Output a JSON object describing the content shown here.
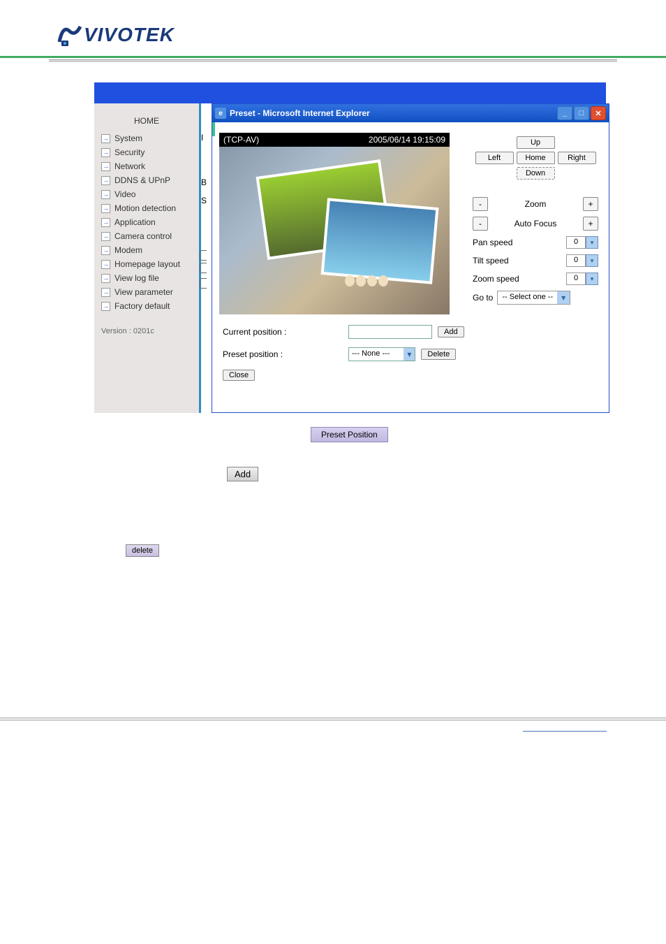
{
  "logo": {
    "text": "VIVOTEK"
  },
  "sidebar": {
    "home": "HOME",
    "items": [
      "System",
      "Security",
      "Network",
      "DDNS & UPnP",
      "Video",
      "Motion detection",
      "Application",
      "Camera control",
      "Modem",
      "Homepage layout",
      "View log file",
      "View parameter",
      "Factory default"
    ],
    "version": "Version : 0201c"
  },
  "window": {
    "title": "Preset - Microsoft Internet Explorer",
    "stream_mode": "(TCP-AV)",
    "timestamp": "2005/06/14 19:15:09"
  },
  "dpad": {
    "up": "Up",
    "down": "Down",
    "left": "Left",
    "right": "Right",
    "home": "Home"
  },
  "controls": {
    "zoom": "Zoom",
    "autofocus": "Auto Focus",
    "pan_speed_label": "Pan speed",
    "tilt_speed_label": "Tilt speed",
    "zoom_speed_label": "Zoom speed",
    "pan_speed": "0",
    "tilt_speed": "0",
    "zoom_speed": "0",
    "minus": "-",
    "plus": "+",
    "goto_label": "Go to",
    "goto_value": "-- Select one --"
  },
  "form": {
    "current_position_label": "Current position :",
    "preset_position_label": "Preset position :",
    "preset_dropdown": "--- None ---",
    "add": "Add",
    "delete": "Delete",
    "close": "Close"
  },
  "buttons": {
    "preset_position": "Preset Position",
    "add": "Add",
    "delete": "delete"
  },
  "letters": [
    "I",
    "B",
    "S"
  ]
}
